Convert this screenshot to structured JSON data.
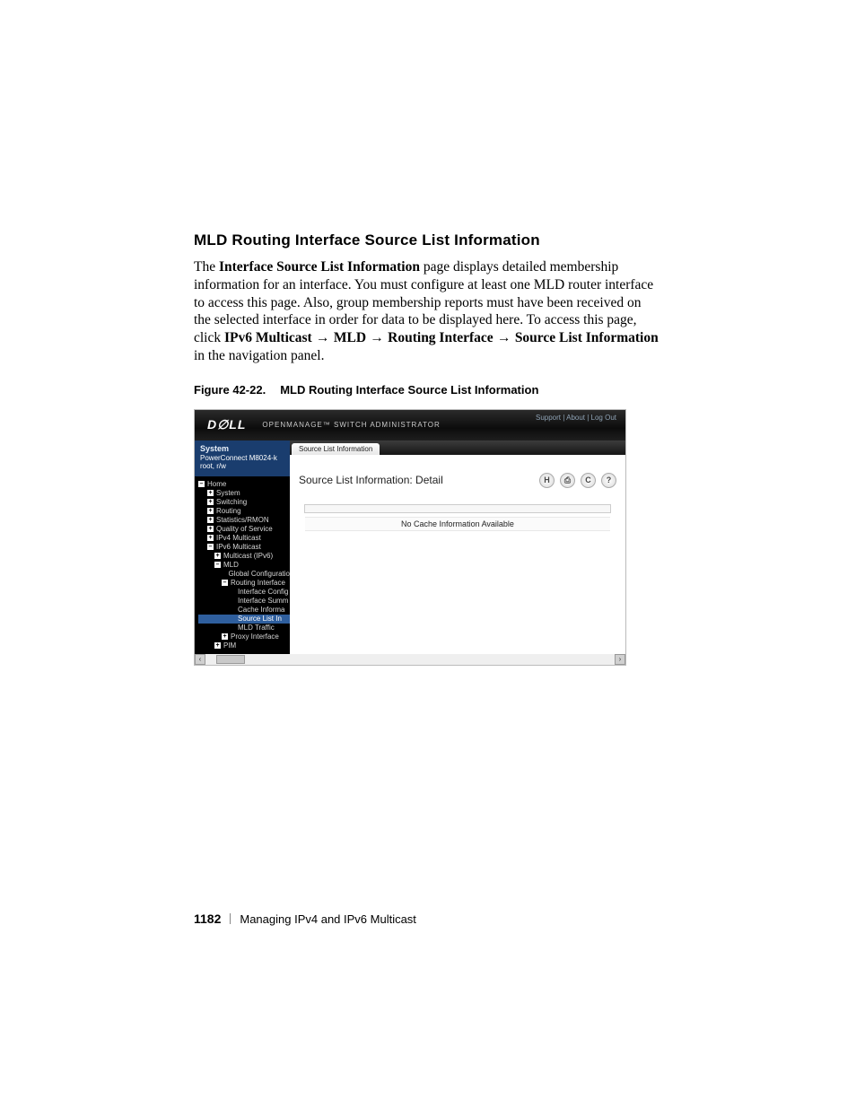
{
  "section_title": "MLD Routing Interface Source List Information",
  "paragraph": {
    "pre": "The ",
    "b1": "Interface Source List Information",
    "mid1": " page displays detailed membership information for an interface. You must configure at least one MLD router interface to access this page. Also, group membership reports must have been received on the selected interface in order for data to be displayed here. To access this page, click ",
    "b2": "IPv6 Multicast",
    "arr": " → ",
    "b3": "MLD",
    "b4": "Routing Interface",
    "b5": "Source List Information",
    "tail": " in the navigation panel."
  },
  "figure_caption": {
    "num": "Figure 42-22.",
    "title": "MLD Routing Interface Source List Information"
  },
  "shot": {
    "logo": "D∅LL",
    "brand": "OPENMANAGE™ SWITCH ADMINISTRATOR",
    "toplinks": "Support  |  About  |  Log Out",
    "sidebar_head": {
      "sys": "System",
      "model": "PowerConnect M8024-k",
      "user": "root, r/w"
    },
    "tree": [
      {
        "lvl": 0,
        "type": "minus",
        "label": "Home"
      },
      {
        "lvl": 1,
        "type": "plus",
        "label": "System"
      },
      {
        "lvl": 1,
        "type": "plus",
        "label": "Switching"
      },
      {
        "lvl": 1,
        "type": "plus",
        "label": "Routing"
      },
      {
        "lvl": 1,
        "type": "plus",
        "label": "Statistics/RMON"
      },
      {
        "lvl": 1,
        "type": "plus",
        "label": "Quality of Service"
      },
      {
        "lvl": 1,
        "type": "plus",
        "label": "IPv4 Multicast"
      },
      {
        "lvl": 1,
        "type": "minus",
        "label": "IPv6 Multicast"
      },
      {
        "lvl": 2,
        "type": "plus",
        "label": "Multicast (IPv6)"
      },
      {
        "lvl": 2,
        "type": "minus",
        "label": "MLD"
      },
      {
        "lvl": 3,
        "type": "none",
        "label": "Global Configuratio"
      },
      {
        "lvl": 3,
        "type": "minus",
        "label": "Routing Interface"
      },
      {
        "lvl": 4,
        "type": "none",
        "label": "Interface Config"
      },
      {
        "lvl": 4,
        "type": "none",
        "label": "Interface Summ"
      },
      {
        "lvl": 4,
        "type": "none",
        "label": "Cache Informa"
      },
      {
        "lvl": 4,
        "type": "none",
        "label": "Source List In",
        "sel": true
      },
      {
        "lvl": 4,
        "type": "none",
        "label": "MLD Traffic"
      },
      {
        "lvl": 3,
        "type": "plus",
        "label": "Proxy Interface"
      },
      {
        "lvl": 2,
        "type": "plus",
        "label": "PIM"
      }
    ],
    "tab": "Source List Information",
    "main_title": "Source List Information: Detail",
    "icons": {
      "save": "H",
      "print": "⎙",
      "refresh": "C",
      "help": "?"
    },
    "result_msg": "No Cache Information Available"
  },
  "footer": {
    "page_num": "1182",
    "chapter": "Managing IPv4 and IPv6 Multicast"
  }
}
